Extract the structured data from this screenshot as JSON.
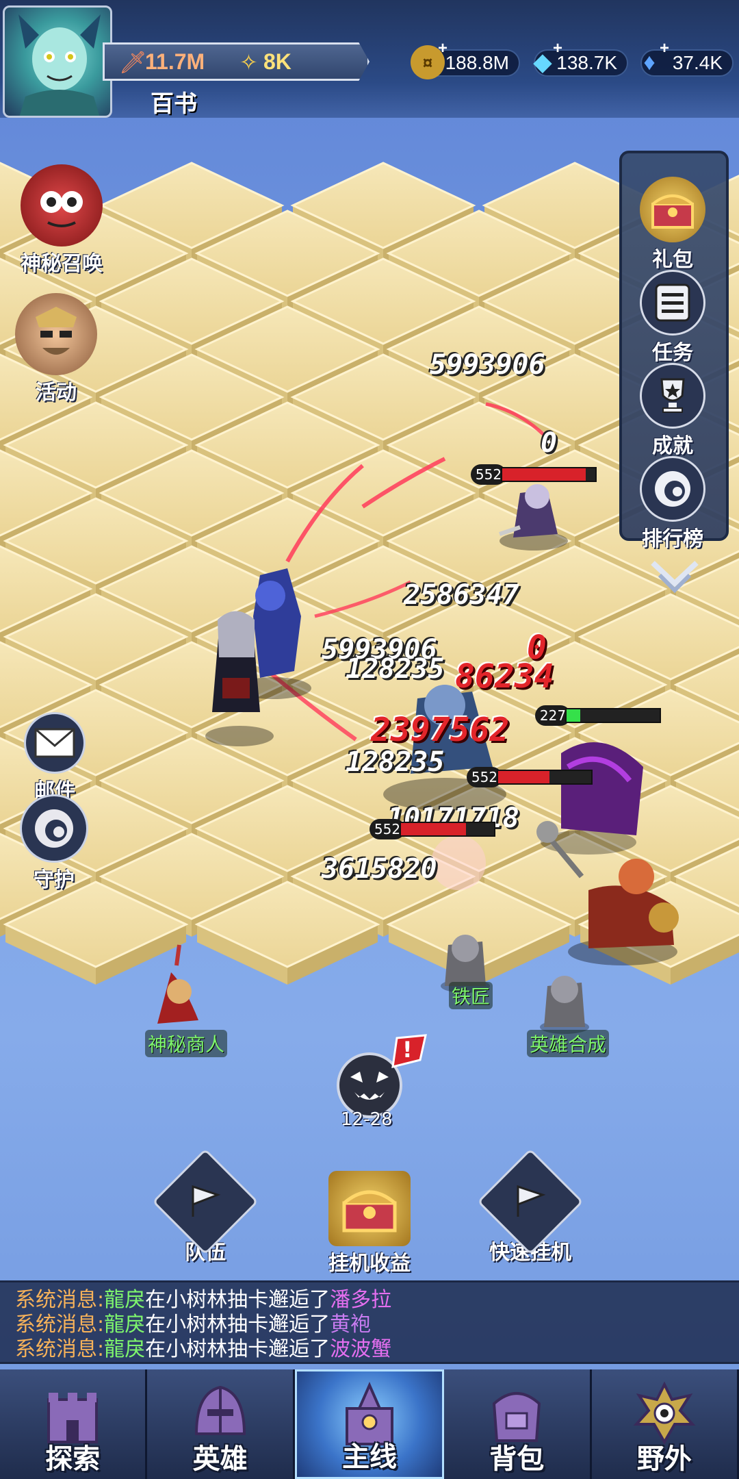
{
  "header": {
    "player_name": "百书",
    "power": "11.7M",
    "stars": "8K",
    "currencies": [
      {
        "name": "gold",
        "value": "188.8M",
        "icon": "gold-coin-icon",
        "color": "#d8b14a"
      },
      {
        "name": "diamond",
        "value": "138.7K",
        "icon": "diamond-icon",
        "color": "#67d8ff"
      },
      {
        "name": "crystal",
        "value": "37.4K",
        "icon": "crystal-icon",
        "color": "#5ea4ff"
      }
    ]
  },
  "left_menu": {
    "summon": "神秘召唤",
    "event": "活动",
    "mail": "邮件",
    "guard": "守护"
  },
  "right_menu": {
    "gift": "礼包",
    "quest": "任务",
    "achievement": "成就",
    "ranking": "排行榜"
  },
  "battle": {
    "damage_numbers": [
      {
        "text": "5993906",
        "style": "white"
      },
      {
        "text": "0",
        "style": "white"
      },
      {
        "text": "2586347",
        "style": "white"
      },
      {
        "text": "5993906",
        "style": "white"
      },
      {
        "text": "128235",
        "style": "white"
      },
      {
        "text": "0",
        "style": "red"
      },
      {
        "text": "86234",
        "style": "red"
      },
      {
        "text": "2397562",
        "style": "red"
      },
      {
        "text": "128235",
        "style": "white"
      },
      {
        "text": "10171718",
        "style": "white"
      },
      {
        "text": "3615820",
        "style": "white"
      }
    ],
    "hp_bars": [
      {
        "level": "552",
        "fill": 0.9,
        "color": "#d8222a"
      },
      {
        "level": "227",
        "fill": 0.15,
        "color": "#35e04a"
      },
      {
        "level": "552",
        "fill": 0.55,
        "color": "#d8222a"
      },
      {
        "level": "552",
        "fill": 0.7,
        "color": "#d8222a"
      }
    ]
  },
  "npcs": {
    "smith": "铁匠",
    "mystery_merchant": "神秘商人",
    "hero_synthesis": "英雄合成"
  },
  "stage": {
    "label": "12-28",
    "alert": "!"
  },
  "actions": {
    "team": "队伍",
    "idle_rewards": "挂机收益",
    "quick_idle": "快速挂机"
  },
  "chat": [
    {
      "prefix": "系统消息:",
      "player": "龍戾",
      "text": "在小树林抽卡邂逅了",
      "item": "潘多拉",
      "item_color": "#e56ff0"
    },
    {
      "prefix": "系统消息:",
      "player": "龍戾",
      "text": "在小树林抽卡邂逅了",
      "item": "黄袍",
      "item_color": "#c87cf0"
    },
    {
      "prefix": "系统消息:",
      "player": "龍戾",
      "text": "在小树林抽卡邂逅了",
      "item": "波波蟹",
      "item_color": "#e56ff0"
    }
  ],
  "nav": [
    {
      "label": "探索",
      "active": false
    },
    {
      "label": "英雄",
      "active": false
    },
    {
      "label": "主线",
      "active": true
    },
    {
      "label": "背包",
      "active": false
    },
    {
      "label": "野外",
      "active": false
    }
  ]
}
